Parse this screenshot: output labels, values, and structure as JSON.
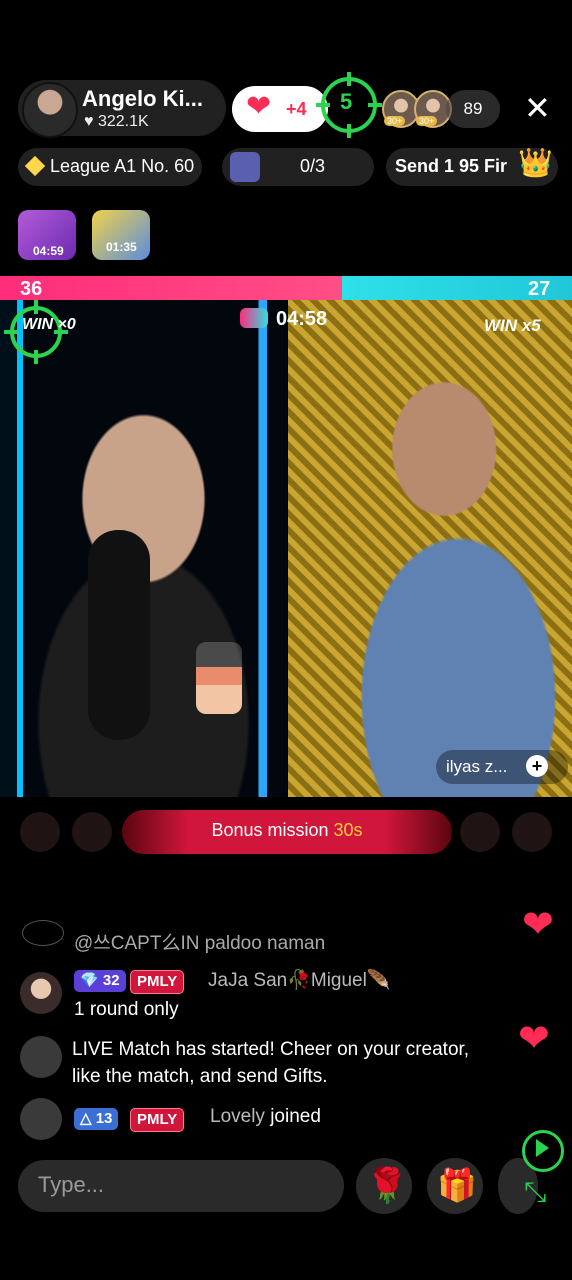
{
  "host": {
    "name": "Angelo Ki...",
    "likes": "322.1K"
  },
  "likes_pill": {
    "count": "+4"
  },
  "target": {
    "number": "5"
  },
  "viewers": {
    "badge1": "30+",
    "badge2": "30+",
    "count": "89"
  },
  "league": {
    "label": "League A1 No. 60"
  },
  "rank": {
    "progress": "0/3"
  },
  "send": {
    "label": "Send 1 95 Fir"
  },
  "timers": {
    "first": "04:59",
    "second": "01:35"
  },
  "score": {
    "left": "36",
    "right": "27"
  },
  "match": {
    "timer": "04:58",
    "left_win": "0",
    "right_win": "WIN x5"
  },
  "guest": {
    "name": "ilyas z..."
  },
  "bonus": {
    "label": "Bonus mission ",
    "seconds": "30s"
  },
  "chat": {
    "prev_message": "@쓰CAPT么IN paldoo naman",
    "msg1": {
      "level": "32",
      "club": "PMLY",
      "user": "JaJa San🥀Miguel🪶",
      "text": "1 round only"
    },
    "system": "LIVE Match has started! Cheer on your creator, like the match, and send Gifts.",
    "join": {
      "level": "13",
      "club": "PMLY",
      "user": "Lovely",
      "action": "joined"
    }
  },
  "input": {
    "placeholder": "Type..."
  },
  "colors": {
    "like": "#ff2d55",
    "target": "#2bd44f",
    "score_left": "#ff2c7a",
    "score_right": "#2ee0e8"
  }
}
